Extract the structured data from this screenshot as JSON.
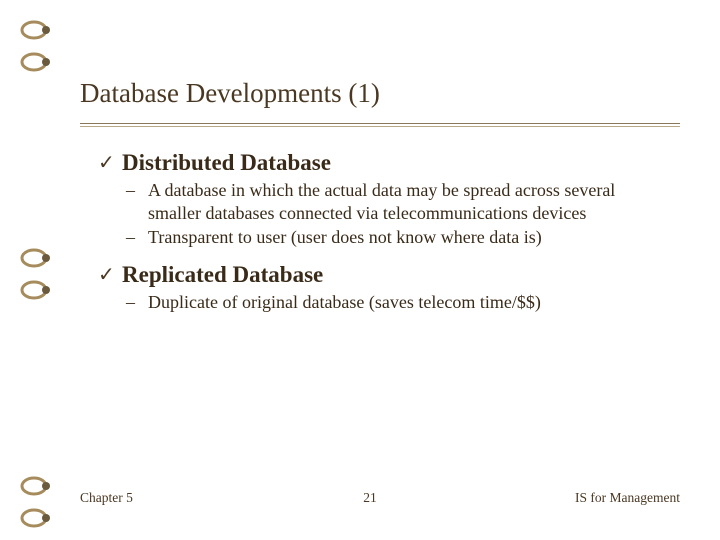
{
  "title": "Database Developments (1)",
  "topics": [
    {
      "heading": "Distributed Database",
      "subs": [
        "A database in which the actual data may be spread across several smaller databases connected via telecommunications devices",
        "Transparent to user (user does not know where data is)"
      ]
    },
    {
      "heading": "Replicated Database",
      "subs": [
        "Duplicate of original database (saves telecom time/$$)"
      ]
    }
  ],
  "footer": {
    "left": "Chapter 5",
    "center": "21",
    "right": "IS for Management"
  }
}
